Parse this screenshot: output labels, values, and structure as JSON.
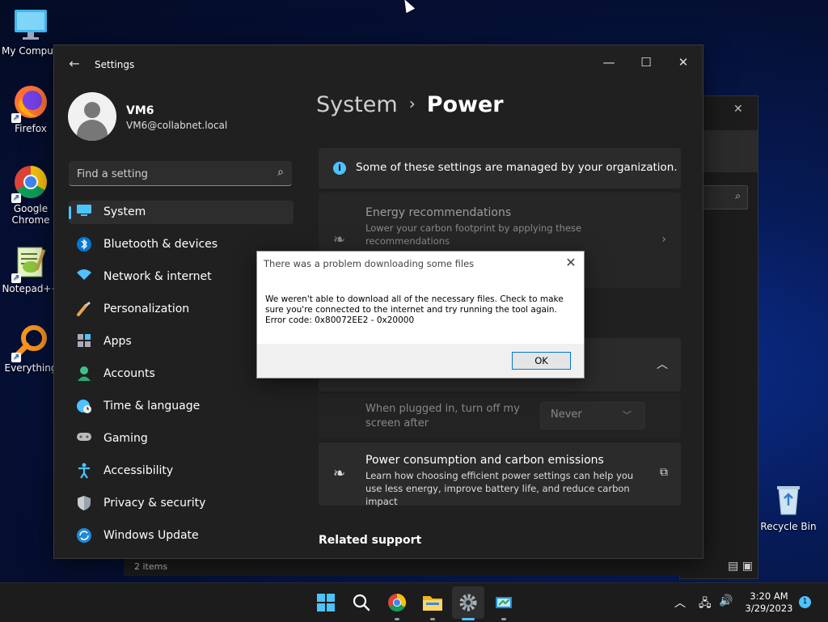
{
  "desktop": {
    "icons": [
      {
        "label": "My Comput"
      },
      {
        "label": "Firefox"
      },
      {
        "label": "Google Chrome"
      },
      {
        "label": "Notepad++"
      },
      {
        "label": "Everything"
      },
      {
        "label": "Recycle Bin"
      }
    ]
  },
  "settings": {
    "title": "Settings",
    "user": {
      "name": "VM6",
      "email": "VM6@collabnet.local"
    },
    "search_placeholder": "Find a setting",
    "nav": [
      {
        "label": "System",
        "icon": "monitor-icon"
      },
      {
        "label": "Bluetooth & devices",
        "icon": "bluetooth-icon"
      },
      {
        "label": "Network & internet",
        "icon": "wifi-icon"
      },
      {
        "label": "Personalization",
        "icon": "brush-icon"
      },
      {
        "label": "Apps",
        "icon": "apps-icon"
      },
      {
        "label": "Accounts",
        "icon": "person-icon"
      },
      {
        "label": "Time & language",
        "icon": "globe-clock-icon"
      },
      {
        "label": "Gaming",
        "icon": "gamepad-icon"
      },
      {
        "label": "Accessibility",
        "icon": "accessibility-icon"
      },
      {
        "label": "Privacy & security",
        "icon": "shield-icon"
      },
      {
        "label": "Windows Update",
        "icon": "update-icon"
      }
    ],
    "breadcrumb": {
      "parent": "System",
      "separator": "›",
      "current": "Power"
    },
    "info_banner": "Some of these settings are managed by your organization.",
    "energy": {
      "title": "Energy recommendations",
      "desc": "Lower your carbon footprint by applying these recommendations"
    },
    "plugged": {
      "label": "When plugged in, turn off my screen after",
      "value": "Never"
    },
    "carbon": {
      "title": "Power consumption and carbon emissions",
      "desc": "Learn how choosing efficient power settings can help you use less energy, improve battery life, and reduce carbon impact"
    },
    "related_support": "Related support"
  },
  "explorer": {
    "status": "2 items"
  },
  "dialog": {
    "title": "There was a problem downloading some files",
    "message_line1": "We weren't able to download all of the necessary files. Check to make sure you're connected to the internet and try running the tool again.",
    "message_line2": "Error code: 0x80072EE2 - 0x20000",
    "ok_label": "OK"
  },
  "taskbar": {
    "time": "3:20 AM",
    "date": "3/29/2023",
    "notification_count": "1"
  },
  "colors": {
    "accent": "#4cc2ff",
    "settings_bg": "#202020",
    "card_bg": "#2b2b2b"
  }
}
